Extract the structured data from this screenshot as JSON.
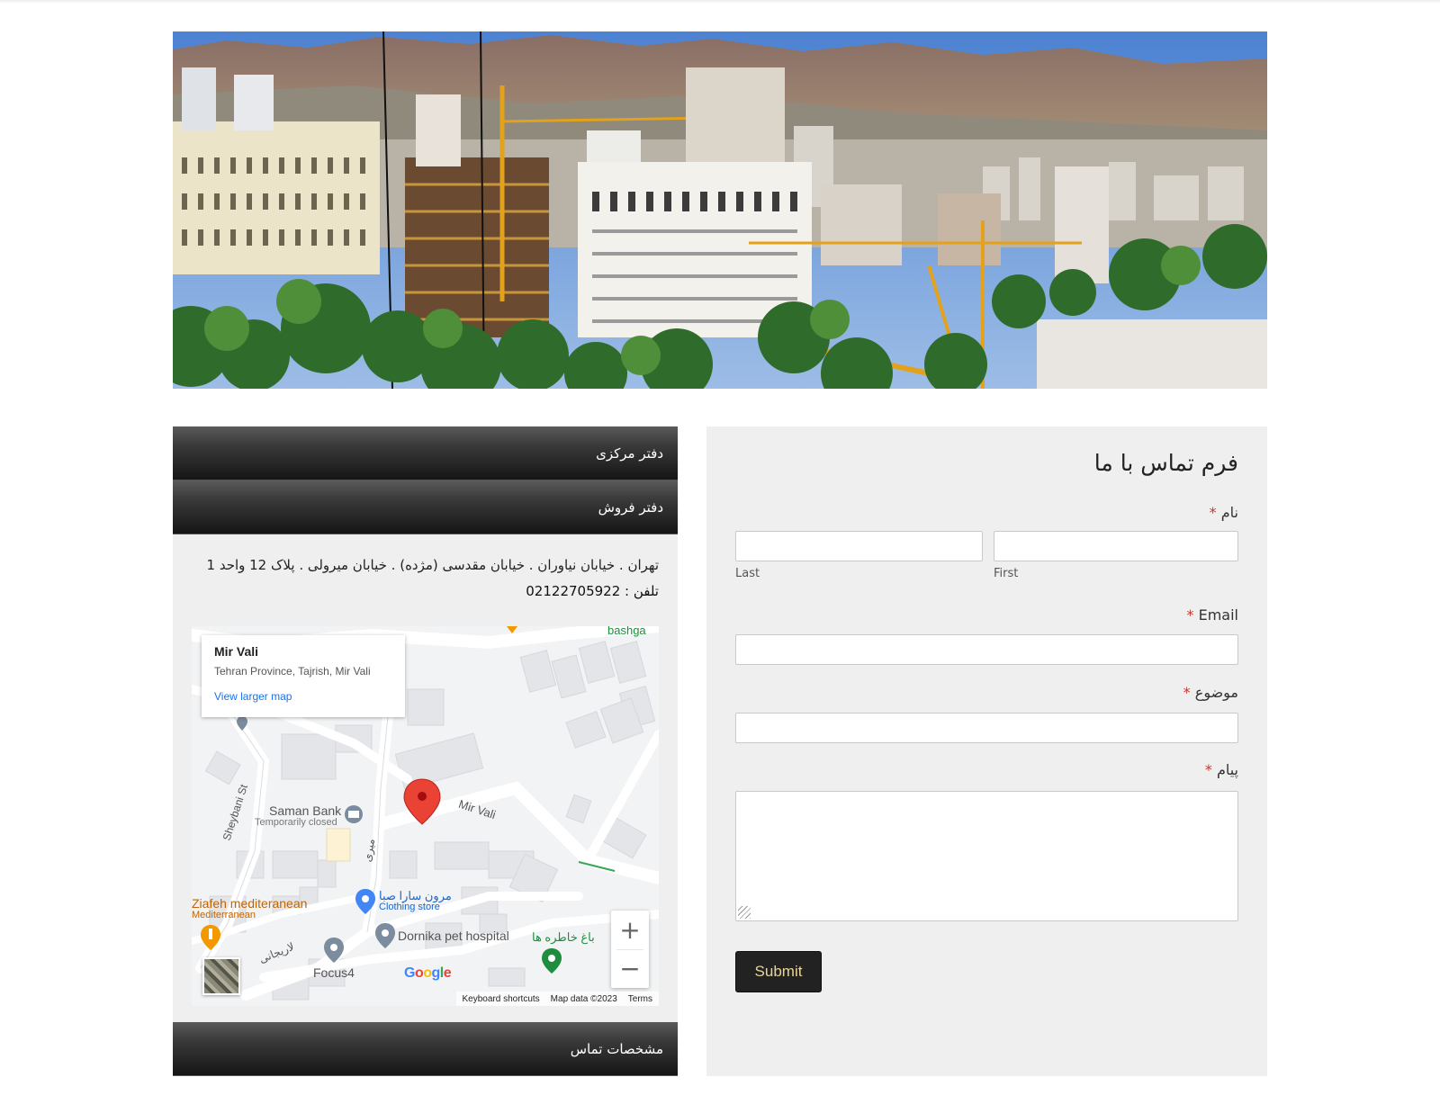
{
  "offices": {
    "head_office_label": "دفتر مرکزی",
    "sales_office_label": "دفتر فروش",
    "address": "تهران . خیابان نیاوران . خیابان مقدسی (مژده) . خیابان میرولی . پلاک 12 واحد 1",
    "phone": "تلفن : 02122705922",
    "contact_details_label": "مشخصات تماس"
  },
  "map": {
    "place_name": "Mir Vali",
    "place_address": "Tehran Province, Tajrish, Mir Vali",
    "larger_map_link": "View larger map",
    "street_label": "Mir Vali",
    "sheybani_label": "Sheybani St",
    "saman_bank": "Saman Bank",
    "saman_status": "Temporarily closed",
    "ziafeh": "Ziafeh mediteranean",
    "ziafeh_sub": "Mediterranean",
    "clothing_store": "مرون سارا صبا",
    "clothing_store_sub": "Clothing store",
    "dornika": "Dornika pet hospital",
    "garden": "باغ خاطره ها",
    "focus4": "Focus4",
    "larijani": "لاریجانی",
    "miri": "میری",
    "bashga": "bashga",
    "footer_shortcuts": "Keyboard shortcuts",
    "footer_data": "Map data ©2023",
    "footer_terms": "Terms",
    "zoom_in": "+",
    "zoom_out": "−",
    "google": [
      "G",
      "o",
      "o",
      "g",
      "l",
      "e"
    ],
    "colors": {
      "pin": "#ea4335",
      "link": "#1a73e8",
      "poi_green": "#1e8e3e",
      "poi_orange": "#e37400",
      "poi_blue": "#4285f4"
    }
  },
  "form": {
    "title": "فرم تماس با ما",
    "required_mark": "*",
    "name_label": "نام",
    "first_sub": "First",
    "last_sub": "Last",
    "email_label": "Email",
    "subject_label": "موضوع",
    "message_label": "پیام",
    "submit": "Submit"
  }
}
